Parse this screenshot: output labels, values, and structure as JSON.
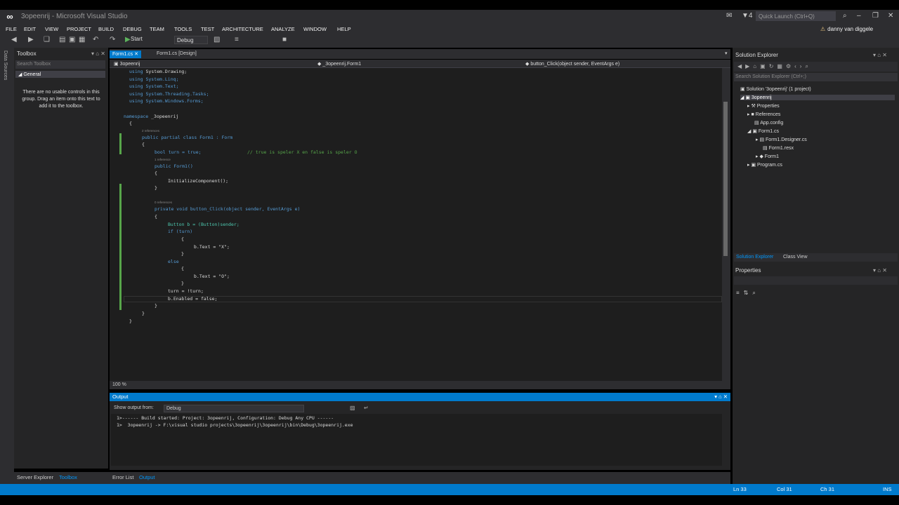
{
  "window": {
    "title": "3opeenrij - Microsoft Visual Studio",
    "quick_launch": "Quick Launch (Ctrl+Q)",
    "user": "danny van diggele",
    "notif_count": "4"
  },
  "menu": [
    "FILE",
    "EDIT",
    "VIEW",
    "PROJECT",
    "BUILD",
    "DEBUG",
    "TEAM",
    "TOOLS",
    "TEST",
    "ARCHITECTURE",
    "ANALYZE",
    "WINDOW",
    "HELP"
  ],
  "toolbar": {
    "start": "Start",
    "config": "Debug"
  },
  "left_strip": {
    "label": "Data Sources"
  },
  "toolbox": {
    "title": "Toolbox",
    "search_placeholder": "Search Toolbox",
    "group": "General",
    "empty_msg": "There are no usable controls in this group. Drag an item onto this text to add it to the toolbox."
  },
  "tabs": [
    {
      "label": "Form1.cs"
    },
    {
      "label": "Form1.cs [Design]"
    }
  ],
  "navbar": {
    "project": "3opeenrij",
    "class": "_3opeenrij.Form1",
    "member": "button_Click(object sender, EventArgs e)"
  },
  "code": {
    "l1": "using System.Drawing;",
    "l2": "using System.Linq;",
    "l3": "using System.Text;",
    "l4": "using System.Threading.Tasks;",
    "l5": "using System.Windows.Forms;",
    "ns_kw": "namespace",
    "ns_name": " _3opeenrij",
    "brace_open": "{",
    "brace_close": "}",
    "ref2": "2 references",
    "ref1": "1 reference",
    "ref0": "0 references",
    "class_line": "public partial class Form1 : Form",
    "bool_line": "bool turn = true;",
    "comment": "// true is speler X en false is speler O",
    "ctor": "public Form1()",
    "init": "InitializeComponent();",
    "method": "private void button_Click(object sender, EventArgs e)",
    "cast": "Button b = (Button)sender;",
    "if": "if (turn)",
    "setx": "b.Text = \"X\";",
    "else": "else",
    "seto": "b.Text = \"O\";",
    "toggle": "turn = !turn;",
    "enabled": "b.Enabled = false;"
  },
  "editor_zoom": "100 %",
  "output": {
    "title": "Output",
    "show_from_label": "Show output from:",
    "source": "Debug",
    "lines": [
      "1>------ Build started: Project: 3opeenrij, Configuration: Debug Any CPU ------",
      "1>  3opeenrij -> F:\\visual studio projects\\3opeenrij\\3opeenrij\\bin\\Debug\\3opeenrij.exe"
    ]
  },
  "bottom_tabs": {
    "left": [
      "Server Explorer",
      "Toolbox"
    ],
    "center": [
      "Error List",
      "Output"
    ]
  },
  "solution_explorer": {
    "title": "Solution Explorer",
    "search_placeholder": "Search Solution Explorer (Ctrl+;)",
    "items": [
      "Solution '3opeenrij' (1 project)",
      "3opeenrij",
      "Properties",
      "References",
      "App.config",
      "Form1.cs",
      "Form1.Designer.cs",
      "Form1.resx",
      "Form1",
      "Program.cs"
    ],
    "tabs": [
      "Solution Explorer",
      "Class View"
    ]
  },
  "properties": {
    "title": "Properties"
  },
  "status": {
    "ln": "Ln 33",
    "col": "Col 31",
    "ch": "Ch 31",
    "mode": "INS"
  }
}
